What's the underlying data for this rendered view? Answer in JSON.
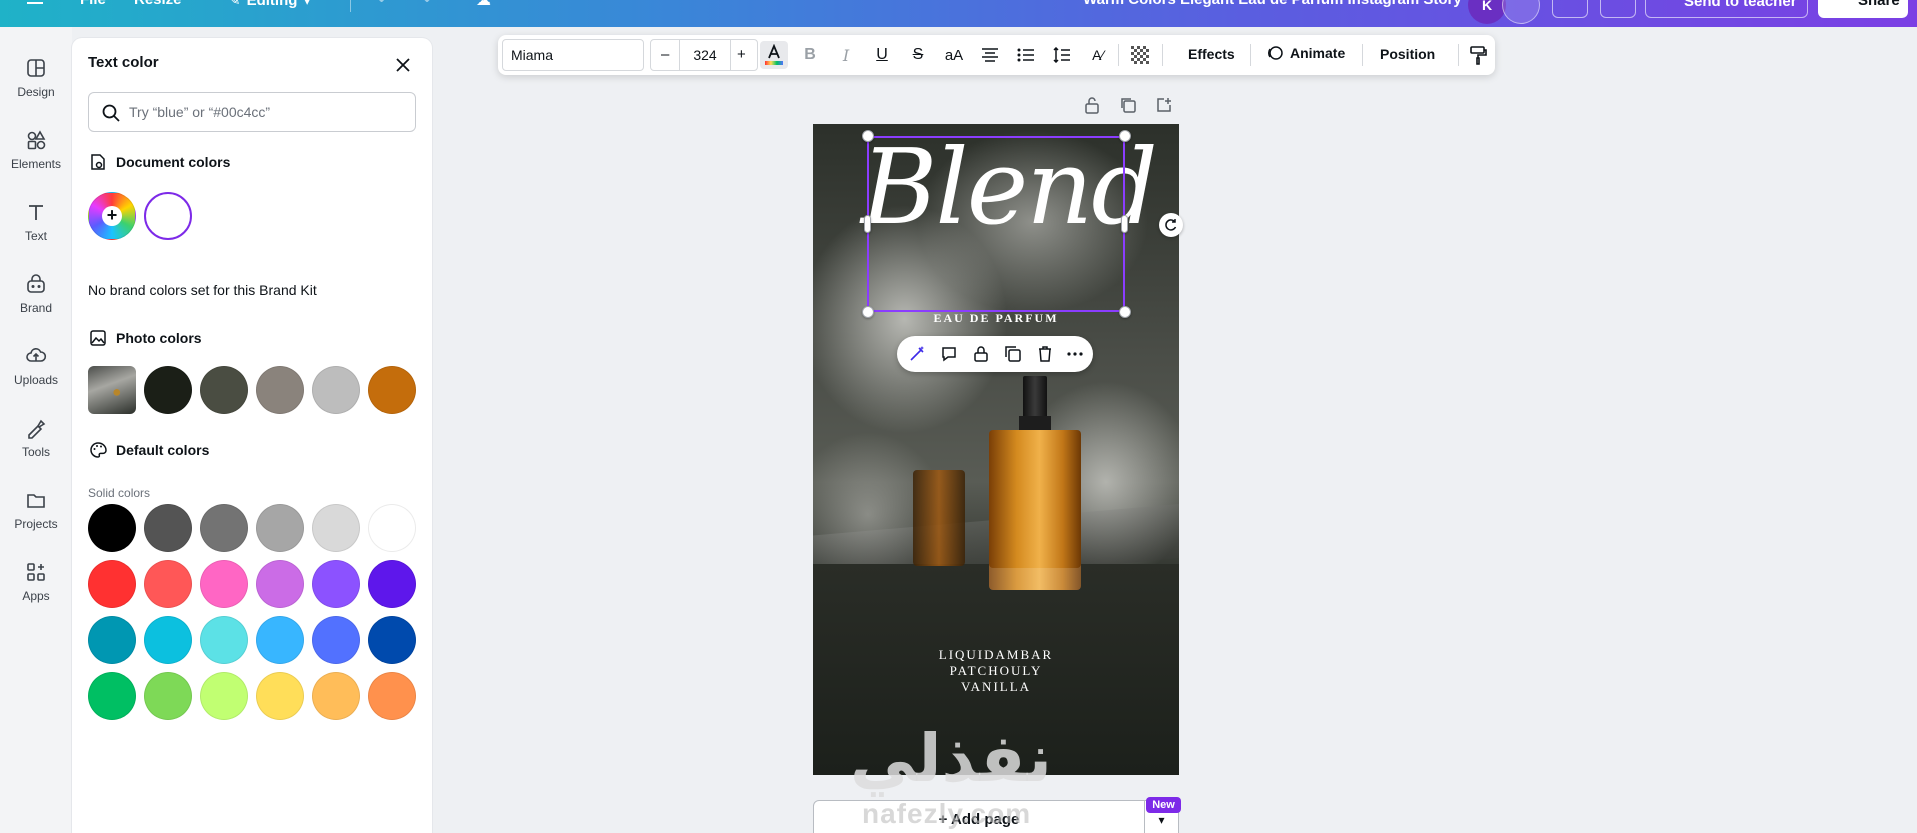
{
  "topbar": {
    "file": "File",
    "resize": "Resize",
    "editing": "Editing",
    "title": "Warm Colors Elegant Eau de Parfum Instagram Story",
    "avatar_initial": "K",
    "send": "Send to teacher",
    "share": "Share"
  },
  "rail": [
    {
      "label": "Design",
      "icon": "design-icon"
    },
    {
      "label": "Elements",
      "icon": "elements-icon"
    },
    {
      "label": "Text",
      "icon": "text-icon"
    },
    {
      "label": "Brand",
      "icon": "brand-icon"
    },
    {
      "label": "Uploads",
      "icon": "uploads-icon"
    },
    {
      "label": "Tools",
      "icon": "tools-icon"
    },
    {
      "label": "Projects",
      "icon": "projects-icon"
    },
    {
      "label": "Apps",
      "icon": "apps-icon"
    }
  ],
  "panel": {
    "title": "Text color",
    "search_placeholder": "Try “blue” or “#00c4cc”",
    "document_colors": "Document colors",
    "no_brand": "No brand colors set for this Brand Kit",
    "photo_colors": "Photo colors",
    "default_colors": "Default colors",
    "solid_colors": "Solid colors",
    "document_swatches": [
      "#ffffff"
    ],
    "photo_swatches": [
      "#1b1f17",
      "#4a4d42",
      "#8a837c",
      "#bdbdbd",
      "#c46d0c"
    ],
    "solid_swatches": [
      [
        "#000000",
        "#545454",
        "#737373",
        "#a6a6a6",
        "#d9d9d9",
        "#ffffff"
      ],
      [
        "#ff3131",
        "#ff5757",
        "#ff66c4",
        "#cb6ce6",
        "#8c52ff",
        "#5e17eb"
      ],
      [
        "#0097b2",
        "#0cc0df",
        "#5ce1e6",
        "#38b6ff",
        "#5271ff",
        "#004aad"
      ],
      [
        "#00bf63",
        "#7ed957",
        "#c1ff72",
        "#ffde59",
        "#ffbd59",
        "#ff914d"
      ]
    ]
  },
  "toolbar": {
    "font": "Miama",
    "minus": "–",
    "size": "324",
    "plus": "+",
    "effects": "Effects",
    "animate": "Animate",
    "position": "Position"
  },
  "canvas": {
    "headline": "Blend",
    "subhead": "EAU DE PARFUM",
    "notes": [
      "LIQUIDAMBAR",
      "PATCHOULY",
      "VANILLA"
    ],
    "watermark": "نفذلي",
    "watermark_latin": "nafezly.com",
    "add_page": "+ Add page",
    "new_badge": "New"
  }
}
